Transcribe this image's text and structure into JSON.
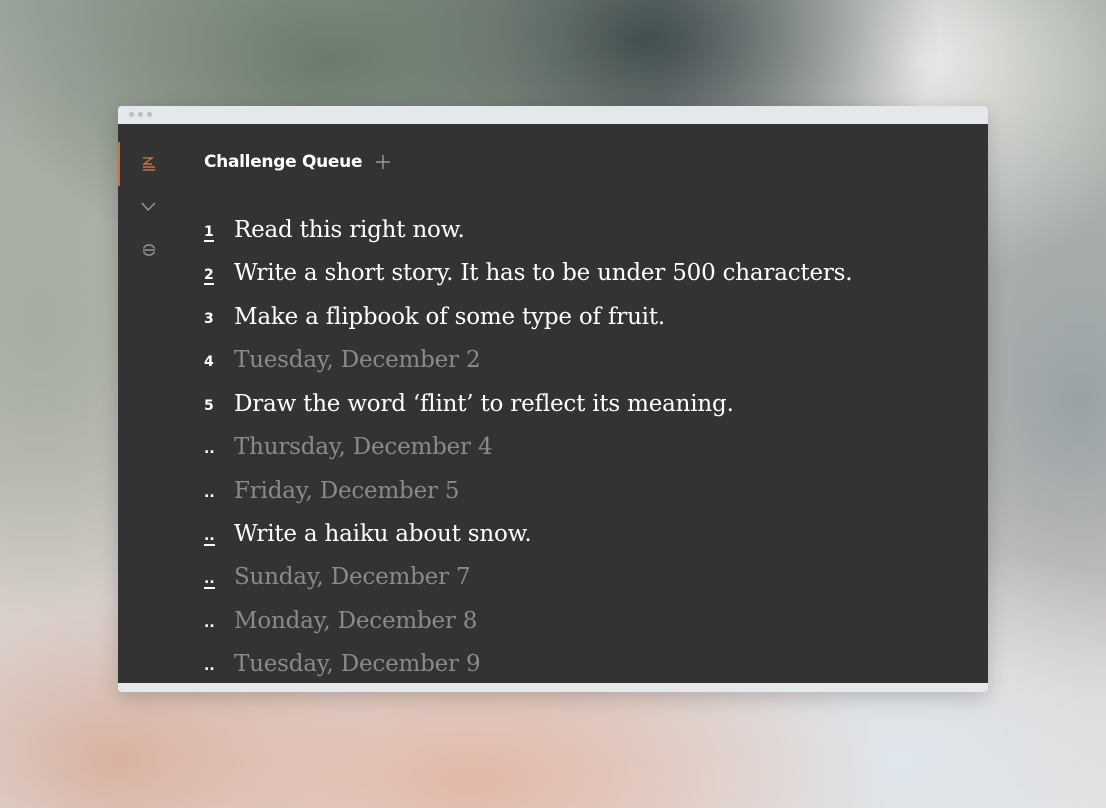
{
  "header": {
    "title": "Challenge Queue",
    "add_icon": "plus-icon"
  },
  "sidebar": {
    "items": [
      {
        "icon": "queue-icon",
        "active": true
      },
      {
        "icon": "check-icon",
        "active": false
      },
      {
        "icon": "sync-icon",
        "active": false
      }
    ]
  },
  "colors": {
    "accent": "#d0704a",
    "panel": "#333333",
    "text": "#ffffff",
    "dim_text": "#8a8a8a"
  },
  "queue": [
    {
      "num": "1",
      "text": "Read this right now.",
      "dim": false,
      "underline": true
    },
    {
      "num": "2",
      "text": "Write a short story. It has to be under 500 characters.",
      "dim": false,
      "underline": true
    },
    {
      "num": "3",
      "text": "Make a flipbook of some type of fruit.",
      "dim": false,
      "underline": false
    },
    {
      "num": "4",
      "text": "Tuesday, December 2",
      "dim": true,
      "underline": false
    },
    {
      "num": "5",
      "text": "Draw the word ‘flint’ to reflect its meaning.",
      "dim": false,
      "underline": false
    },
    {
      "num": "..",
      "text": "Thursday, December 4",
      "dim": true,
      "underline": false
    },
    {
      "num": "..",
      "text": "Friday, December 5",
      "dim": true,
      "underline": false
    },
    {
      "num": "..",
      "text": "Write a haiku about snow.",
      "dim": false,
      "underline": true
    },
    {
      "num": "..",
      "text": "Sunday, December 7",
      "dim": true,
      "underline": true
    },
    {
      "num": "..",
      "text": "Monday, December 8",
      "dim": true,
      "underline": false
    },
    {
      "num": "..",
      "text": "Tuesday, December 9",
      "dim": true,
      "underline": false
    }
  ]
}
